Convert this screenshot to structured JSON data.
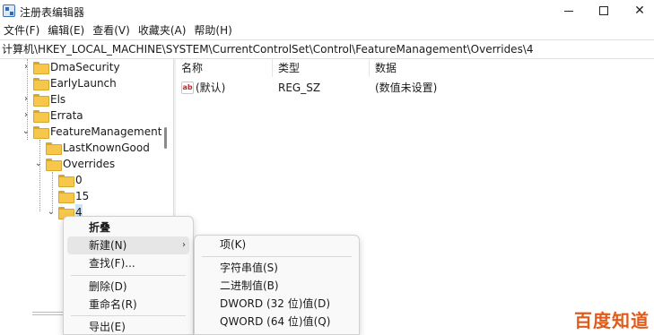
{
  "window": {
    "title": "注册表编辑器",
    "minimize_icon": "minimize-icon",
    "maximize_icon": "maximize-icon",
    "close_glyph": "✕"
  },
  "menubar": {
    "items": [
      "文件(F)",
      "编辑(E)",
      "查看(V)",
      "收藏夹(A)",
      "帮助(H)"
    ]
  },
  "address": {
    "path": "计算机\\HKEY_LOCAL_MACHINE\\SYSTEM\\CurrentControlSet\\Control\\FeatureManagement\\Overrides\\4"
  },
  "tree": {
    "items": [
      {
        "label": "DmaSecurity",
        "expander": "›"
      },
      {
        "label": "EarlyLaunch",
        "expander": ""
      },
      {
        "label": "Els",
        "expander": "›"
      },
      {
        "label": "Errata",
        "expander": "›"
      },
      {
        "label": "FeatureManagement",
        "expander": "⌄"
      },
      {
        "label": "LastKnownGood",
        "expander": ""
      },
      {
        "label": "Overrides",
        "expander": "⌄"
      },
      {
        "label": "0",
        "expander": ""
      },
      {
        "label": "15",
        "expander": ""
      },
      {
        "label": "4",
        "expander": "⌄",
        "selected": true
      }
    ]
  },
  "list": {
    "headers": {
      "name": "名称",
      "type": "类型",
      "data": "数据"
    },
    "rows": [
      {
        "icon": "ab",
        "name": "(默认)",
        "type": "REG_SZ",
        "data": "(数值未设置)"
      }
    ]
  },
  "context_menu": {
    "collapse": "折叠",
    "new": "新建(N)",
    "find": "查找(F)...",
    "delete": "删除(D)",
    "rename": "重命名(R)",
    "export": "导出(E)",
    "submenu_arrow": "›"
  },
  "new_submenu": {
    "key": "项(K)",
    "string": "字符串值(S)",
    "binary": "二进制值(B)",
    "dword": "DWORD (32 位)值(D)",
    "qword": "QWORD (64 位)值(Q)"
  },
  "watermark": {
    "text": "百度知道"
  },
  "colors": {
    "accent": "#0067c0",
    "folder": "#f6c74a",
    "selection": "#cfe3f7",
    "watermark": "#e05a1b"
  }
}
